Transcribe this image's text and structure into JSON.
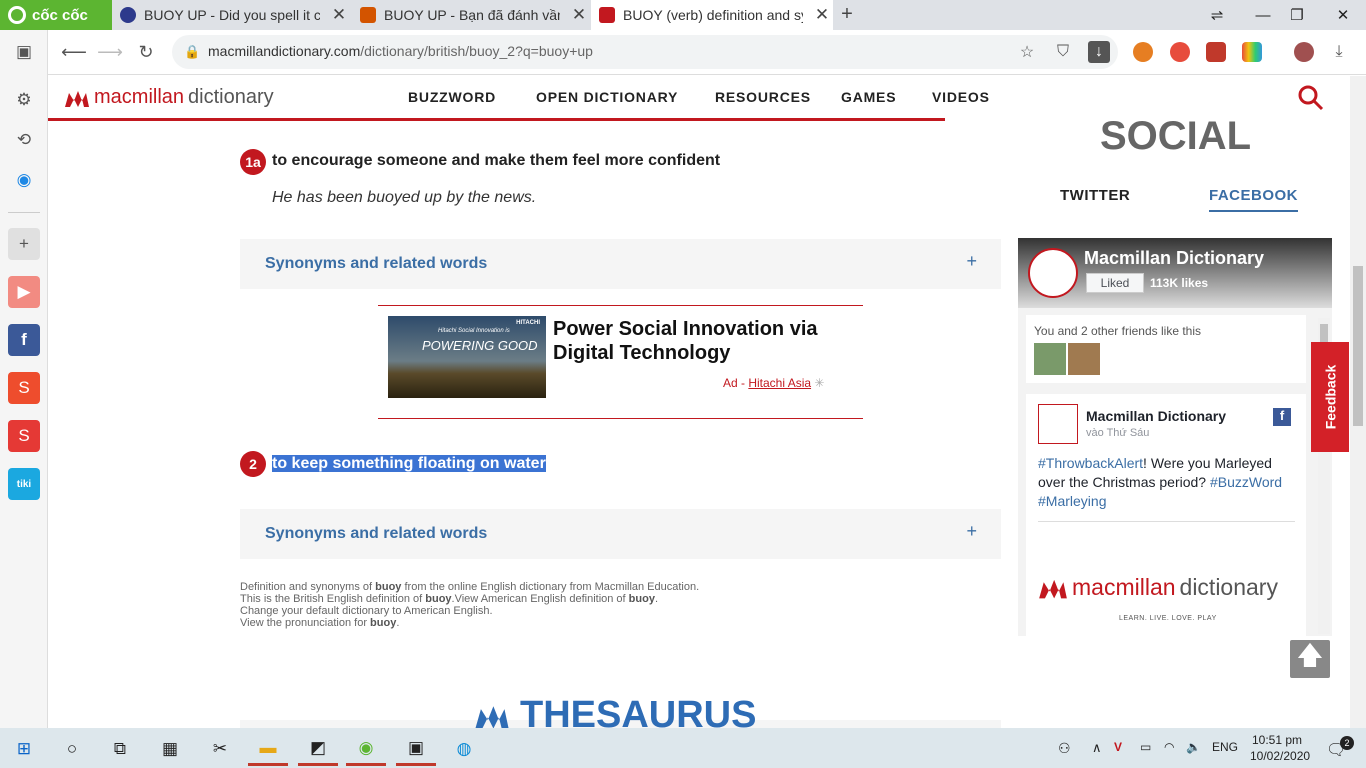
{
  "browser": {
    "name": "cốc cốc",
    "tabs": [
      {
        "title": "BUOY UP - Did you spell it correctly",
        "active": false
      },
      {
        "title": "BUOY UP - Bạn đã đánh vần đúng",
        "active": false
      },
      {
        "title": "BUOY (verb) definition and synonyms",
        "active": true
      }
    ],
    "new_tab": "+",
    "window_controls": {
      "menu": "⇌",
      "minimize": "—",
      "maximize": "❐",
      "close": "✕"
    },
    "url_host": "macmillandictionary.com",
    "url_path": "/dictionary/british/buoy_2?q=buoy+up"
  },
  "site": {
    "logo_brand": "macmillan",
    "logo_product": "dictionary",
    "nav": [
      "BUZZWORD",
      "OPEN DICTIONARY",
      "RESOURCES",
      "GAMES",
      "VIDEOS"
    ]
  },
  "definitions": [
    {
      "number": "1a",
      "text": "to encourage someone and make them feel more confident",
      "example": "He has been buoyed up by the news."
    },
    {
      "number": "2",
      "text": "to keep something floating on water",
      "example": ""
    }
  ],
  "synonyms_label": "Synonyms and related words",
  "synonyms_plus": "+",
  "ad": {
    "title": "Power Social Innovation via Digital Technology",
    "ad_prefix": "Ad - ",
    "advertiser": "Hitachi Asia",
    "image_text_top": "Hitachi Social Innovation is",
    "image_text_main": "POWERING GOOD",
    "image_brand": "HITACHI"
  },
  "footer": {
    "line1_a": "Definition and synonyms of ",
    "line1_b": "buoy",
    "line1_c": " from the online English dictionary from Macmillan Education.",
    "line2_a": "This is the British English definition of ",
    "line2_b": "buoy",
    "line2_c": ".View American English definition of ",
    "line2_d": "buoy",
    "line2_e": ".",
    "line3": "Change your default dictionary to American English.",
    "line4_a": "View the pronunciation for ",
    "line4_b": "buoy",
    "line4_c": "."
  },
  "thesaurus": "THESAURUS",
  "social": {
    "title": "SOCIAL",
    "tabs": [
      "TWITTER",
      "FACEBOOK"
    ],
    "active_tab": "FACEBOOK",
    "fb_page_name": "Macmillan Dictionary",
    "fb_liked": "Liked",
    "fb_likes": "113K likes",
    "friends_text": "You and 2 other friends like this",
    "post_author": "Macmillan Dictionary",
    "post_time": "vào Thứ Sáu",
    "post_tag1": "#ThrowbackAlert",
    "post_body1": "! Were you Marleyed over the Christmas period? ",
    "post_tag2": "#BuzzWord",
    "post_tag3": "#Marleying",
    "post_logo_brand": "macmillan",
    "post_logo_product": "dictionary",
    "post_tagline": "LEARN. LIVE. LOVE. PLAY"
  },
  "feedback": "Feedback",
  "taskbar": {
    "language": "ENG",
    "time": "10:51 pm",
    "date": "10/02/2020",
    "notif": "2"
  },
  "colors": {
    "brand_red": "#c2181f",
    "link_blue": "#3b6ea5",
    "selection": "#3b73d3"
  }
}
